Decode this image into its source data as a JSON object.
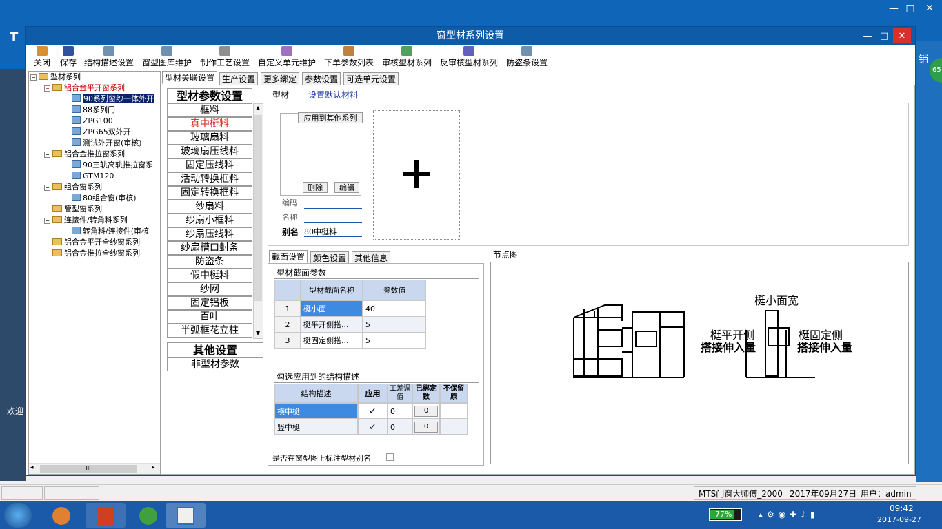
{
  "dialog": {
    "title": "窗型材系列设置"
  },
  "toolbar": [
    {
      "label": "关闭",
      "icon": "exit-icon"
    },
    {
      "label": "保存",
      "icon": "save-icon"
    },
    {
      "label": "结构描述设置",
      "icon": "edit-icon"
    },
    {
      "label": "窗型图库维护",
      "icon": "edit-icon"
    },
    {
      "label": "制作工艺设置",
      "icon": "tools-icon"
    },
    {
      "label": "自定义单元维护",
      "icon": "unit-icon"
    },
    {
      "label": "下单参数列表",
      "icon": "list-icon"
    },
    {
      "label": "审核型材系列",
      "icon": "audit-icon"
    },
    {
      "label": "反审核型材系列",
      "icon": "undo-icon"
    },
    {
      "label": "防盗条设置",
      "icon": "edit-icon"
    }
  ],
  "tree": [
    {
      "label": "型材系列",
      "level": 0
    },
    {
      "label": "铝合金平开窗系列",
      "level": 1
    },
    {
      "label": "90系列窗纱一体外开",
      "level": 2
    },
    {
      "label": "88系列门",
      "level": 2
    },
    {
      "label": "ZPG100",
      "level": 2
    },
    {
      "label": "ZPG65双外开",
      "level": 2
    },
    {
      "label": "测试外开窗(审核)",
      "level": 2
    },
    {
      "label": "铝合金推拉窗系列",
      "level": 1
    },
    {
      "label": "90三轨高轨推拉窗系",
      "level": 2
    },
    {
      "label": "GTM120",
      "level": 2
    },
    {
      "label": "组合窗系列",
      "level": 1
    },
    {
      "label": "80组合窗(审核)",
      "level": 2
    },
    {
      "label": "管型窗系列",
      "level": 1
    },
    {
      "label": "连接件/转角料系列",
      "level": 1
    },
    {
      "label": "转角料/连接件(审核",
      "level": 2
    },
    {
      "label": "铝合金平开全纱窗系列",
      "level": 1
    },
    {
      "label": "铝合金推拉全纱窗系列",
      "level": 1
    }
  ],
  "tree_scroll": "III",
  "tabs": [
    "型材关联设置",
    "生产设置",
    "更多绑定",
    "参数设置",
    "可选单元设置"
  ],
  "param_header": "型材参数设置",
  "param_list": [
    "框料",
    "真中梃料",
    "玻璃扇料",
    "玻璃扇压线料",
    "固定压线料",
    "活动转换框料",
    "固定转换框料",
    "纱扇料",
    "纱扇小框料",
    "纱扇压线料",
    "纱扇槽口封条",
    "防盗条",
    "假中梃料",
    "纱网",
    "固定铝板",
    "百叶",
    "半弧框花立柱"
  ],
  "other_header": "其他设置",
  "other_list": [
    "非型材参数"
  ],
  "material": {
    "label": "型材",
    "default_link": "设置默认材料",
    "apply_button": "应用到其他系列",
    "delete_button": "删除",
    "edit_button": "编辑",
    "code_label": "编码",
    "code_value": "",
    "name_label": "名称",
    "name_value": "",
    "alias_label": "别名",
    "alias_value": "80中梃料"
  },
  "sub_tabs": [
    "截面设置",
    "颜色设置",
    "其他信息"
  ],
  "section": {
    "title": "型材截面参数",
    "headers": [
      "型材截面名称",
      "参数值"
    ],
    "rows": [
      {
        "no": "1",
        "name": "梃小面",
        "value": "40"
      },
      {
        "no": "2",
        "name": "梃平开侧搭...",
        "value": "5"
      },
      {
        "no": "3",
        "name": "梃固定侧搭...",
        "value": "5"
      }
    ]
  },
  "struct": {
    "title": "勾选应用到的结构描述",
    "headers": [
      "结构描述",
      "应用",
      "工差调值",
      "已绑定数",
      "不保留原"
    ],
    "rows": [
      {
        "name": "横中梃",
        "apply": "✓",
        "adjust": "0",
        "bound": "0"
      },
      {
        "name": "竖中梃",
        "apply": "✓",
        "adjust": "0",
        "bound": "0"
      }
    ]
  },
  "alias_check_label": "是否在窗型图上标注型材别名",
  "node_title": "节点图",
  "node_labels": {
    "top": "梃小面宽",
    "left1": "梃平开侧",
    "left2": "搭接伸入量",
    "right1": "梃固定侧",
    "right2": "搭接伸入量"
  },
  "status": {
    "app": "MTS门窗大师傅_2000",
    "date": "2017年09月27日",
    "user": "用户：admin"
  },
  "taskbar": {
    "battery": "77%",
    "time": "09:42",
    "date": "2017-09-27"
  },
  "bg": {
    "badge": "65",
    "side_text": "欢迎",
    "right_text": "销"
  }
}
